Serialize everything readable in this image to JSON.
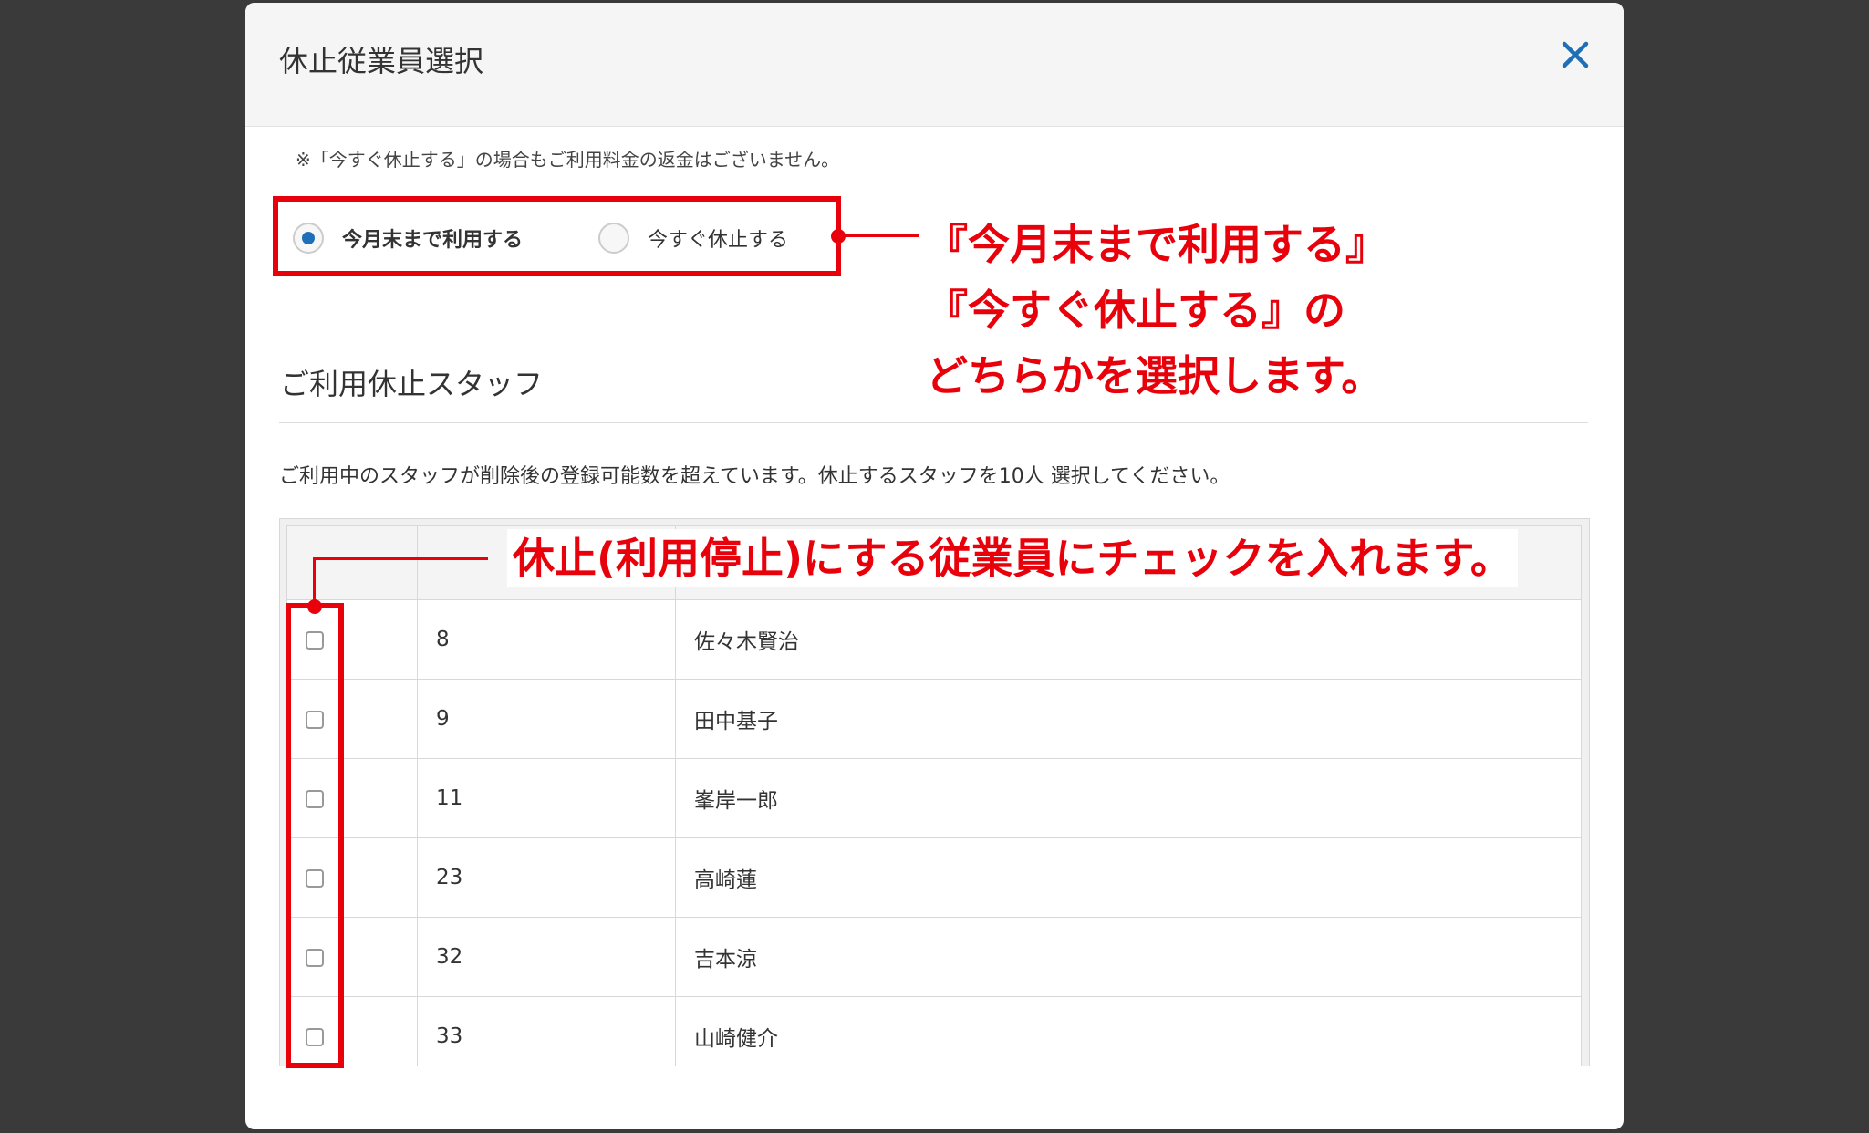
{
  "modal": {
    "title": "休止従業員選択",
    "close_glyph": "✕",
    "notice": "※「今すぐ休止する」の場合もご利用料金の返金はございません。",
    "radio_options": [
      {
        "label": "今月末まで利用する",
        "checked": true
      },
      {
        "label": "今すぐ休止する",
        "checked": false
      }
    ],
    "section_title": "ご利用休止スタッフ",
    "instruction": "ご利用中のスタッフが削除後の登録可能数を超えています。休止するスタッフを10人 選択してください。",
    "table": {
      "rows": [
        {
          "id": "8",
          "name": "佐々木賢治"
        },
        {
          "id": "9",
          "name": "田中基子"
        },
        {
          "id": "11",
          "name": "峯岸一郎"
        },
        {
          "id": "23",
          "name": "高崎蓮"
        },
        {
          "id": "32",
          "name": "吉本涼"
        },
        {
          "id": "33",
          "name": "山崎健介"
        }
      ]
    }
  },
  "annotations": {
    "callout1_line1": "『今月末まで利用する』",
    "callout1_line2": "『今すぐ休止する』の",
    "callout1_line3": "どちらかを選択します。",
    "callout2": "休止(利用停止)にする従業員にチェックを入れます。"
  },
  "colors": {
    "accent_red": "#e8000b",
    "radio_blue": "#1f6fb8",
    "close_blue": "#1f6fb8"
  },
  "icons": {
    "close": "close-icon"
  }
}
